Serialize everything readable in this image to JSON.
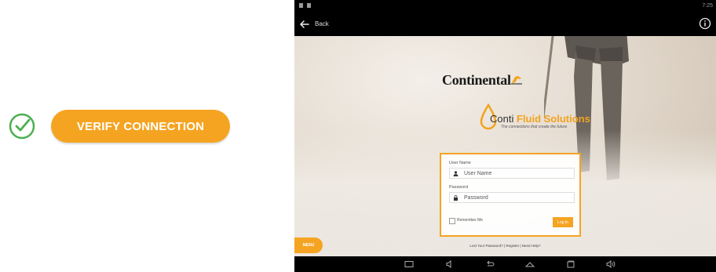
{
  "verify": {
    "label": "VERIFY CONNECTION",
    "check_icon": "check-circle-icon",
    "accent": "#f5a422",
    "check_color": "#4caf50"
  },
  "tablet": {
    "status_time": "7:25",
    "back_label": "Back",
    "brand_name": "Continental",
    "fluid_title_prefix": "Conti",
    "fluid_title_suffix": " Fluid Solutions",
    "fluid_tagline": "The connections that create the future",
    "login": {
      "username_label": "User Name",
      "username_placeholder": "User Name",
      "password_label": "Password",
      "password_placeholder": "Password",
      "remember_label": "Remember Me",
      "login_button": "Log In"
    },
    "links": "Lost Your Password? | Register | Need Help?",
    "menu_label": "MENU"
  }
}
